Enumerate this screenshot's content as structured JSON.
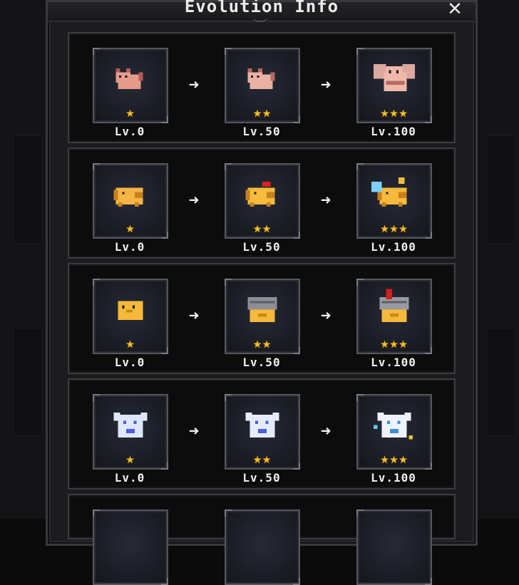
{
  "title": "Evolution Info",
  "close_glyph": "✕",
  "colors": {
    "star": "#f3c021",
    "panel": "#1c1c1e",
    "row": "#0c0c0d"
  },
  "arrow_glyph": "➜",
  "evolutions": [
    {
      "stages": [
        {
          "level": "Lv.0",
          "stars": "★",
          "pet_icon": "cat-icon",
          "pet_colors": [
            "#e69a8a",
            "#b25b58"
          ]
        },
        {
          "level": "Lv.50",
          "stars": "★★",
          "pet_icon": "cat-icon",
          "pet_colors": [
            "#eab0a4",
            "#b86a64"
          ]
        },
        {
          "level": "Lv.100",
          "stars": "★★★",
          "pet_icon": "winged-cat-icon",
          "pet_colors": [
            "#f0b8ab",
            "#b86a64"
          ]
        }
      ]
    },
    {
      "stages": [
        {
          "level": "Lv.0",
          "stars": "★",
          "pet_icon": "pig-icon",
          "pet_colors": [
            "#f5b545",
            "#c7811c"
          ]
        },
        {
          "level": "Lv.50",
          "stars": "★★",
          "pet_icon": "pig-bow-icon",
          "pet_colors": [
            "#f6bb3d",
            "#c7811c"
          ]
        },
        {
          "level": "Lv.100",
          "stars": "★★★",
          "pet_icon": "winged-pig-icon",
          "pet_colors": [
            "#f6bb3d",
            "#c7811c"
          ]
        }
      ]
    },
    {
      "stages": [
        {
          "level": "Lv.0",
          "stars": "★",
          "pet_icon": "chick-icon",
          "pet_colors": [
            "#f6b93a",
            "#c98a18"
          ]
        },
        {
          "level": "Lv.50",
          "stars": "★★",
          "pet_icon": "helmet-chick-icon",
          "pet_colors": [
            "#f6b93a",
            "#8e8e96"
          ]
        },
        {
          "level": "Lv.100",
          "stars": "★★★",
          "pet_icon": "knight-chick-icon",
          "pet_colors": [
            "#f6b93a",
            "#9a9aa2"
          ]
        }
      ]
    },
    {
      "stages": [
        {
          "level": "Lv.0",
          "stars": "★",
          "pet_icon": "ghost-bird-icon",
          "pet_colors": [
            "#dfe6ff",
            "#4b5ee0"
          ]
        },
        {
          "level": "Lv.50",
          "stars": "★★",
          "pet_icon": "ghost-cat-icon",
          "pet_colors": [
            "#e6ecff",
            "#4b5ee0"
          ]
        },
        {
          "level": "Lv.100",
          "stars": "★★★",
          "pet_icon": "ghost-angel-icon",
          "pet_colors": [
            "#eef2ff",
            "#3a8fd8"
          ]
        }
      ]
    }
  ]
}
